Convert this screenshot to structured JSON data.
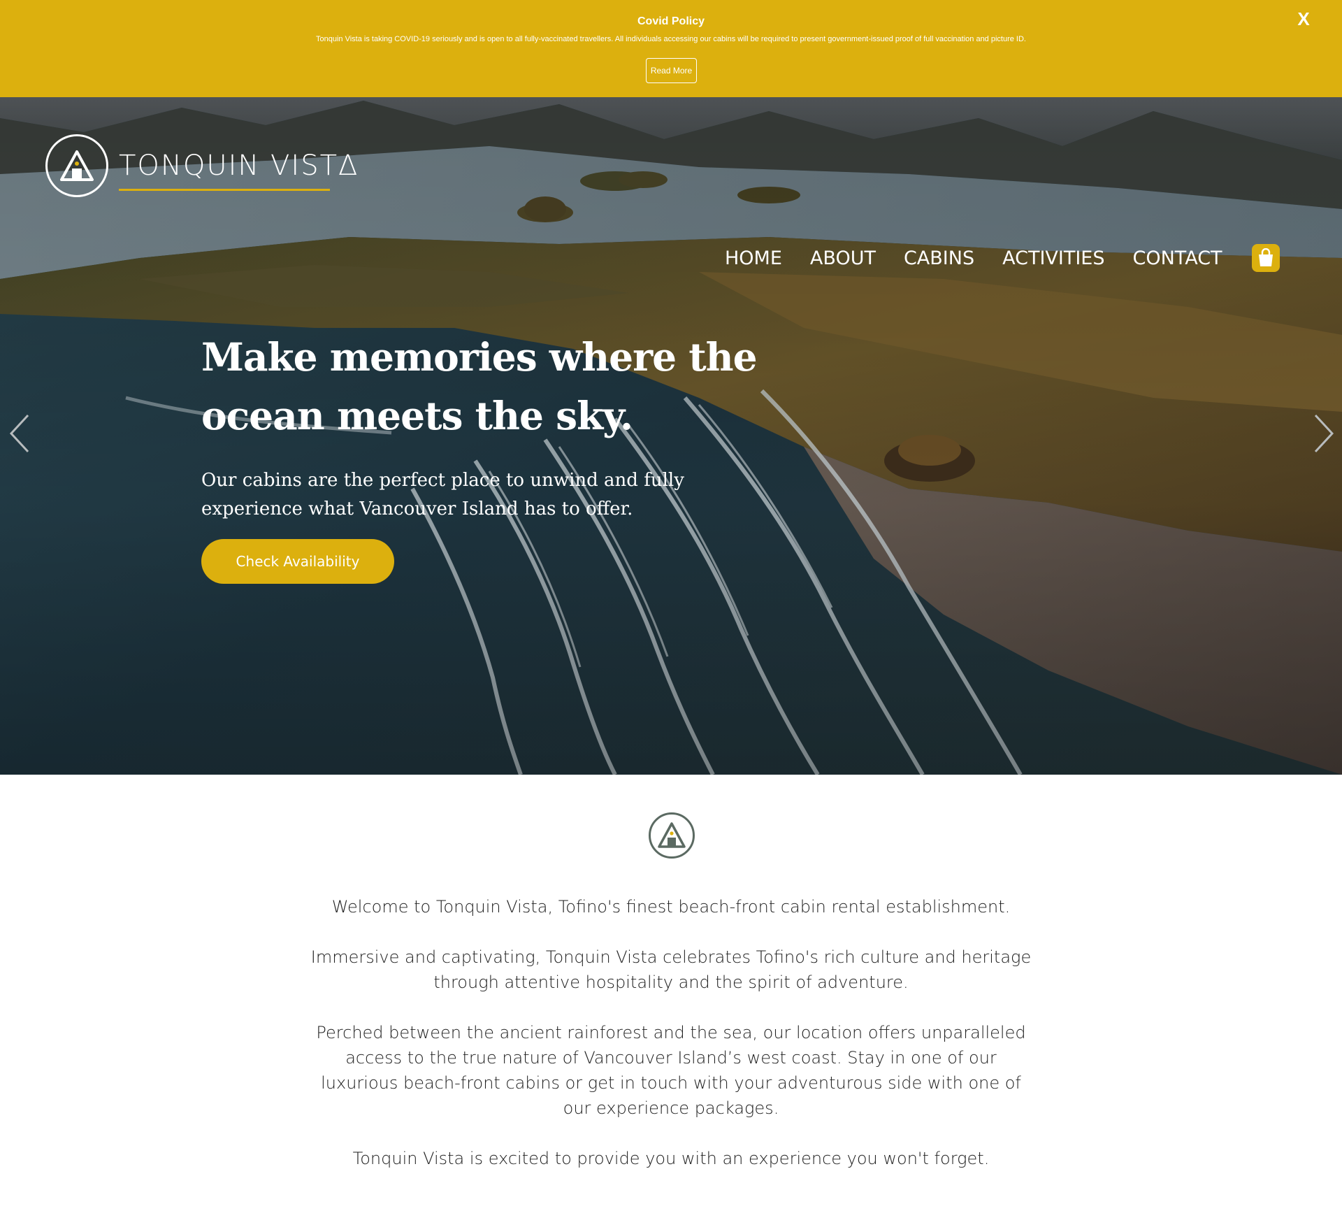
{
  "covid": {
    "title": "Covid Policy",
    "text": "Tonquin Vista is taking COVID-19 seriously and is open to all fully-vaccinated travellers. All individuals accessing our cabins will be required to present government-issued proof of full vaccination and picture ID.",
    "read_more": "Read More",
    "close": "X"
  },
  "brand": {
    "name": "TONQUIN VISTΔ",
    "accent": "#dcb00e",
    "emblem_color": "#5b6a62"
  },
  "nav": {
    "items": [
      "HOME",
      "ABOUT",
      "CABINS",
      "ACTIVITIES",
      "CONTACT"
    ],
    "cart_icon": "shopping-bag-icon"
  },
  "hero": {
    "headline": "Make memories where the ocean meets the sky.",
    "subheading": "Our cabins are the perfect place to unwind and fully experience what Vancouver Island has to offer.",
    "cta": "Check Availability",
    "prev_icon": "chevron-left-icon",
    "next_icon": "chevron-right-icon"
  },
  "welcome": {
    "paragraphs": [
      "Welcome to Tonquin Vista, Tofino's finest beach-front cabin rental establishment.",
      "Immersive and captivating, Tonquin Vista celebrates Tofino's rich culture and heritage through attentive hospitality and the spirit of adventure.",
      "Perched between the ancient rainforest and the sea, our location offers unparalleled access to the true nature of Vancouver Island’s west coast. Stay in one of our luxurious beach-front cabins or get in touch with your adventurous side with one of our experience packages.",
      "Tonquin Vista is excited to provide you with an experience you won't forget."
    ]
  }
}
